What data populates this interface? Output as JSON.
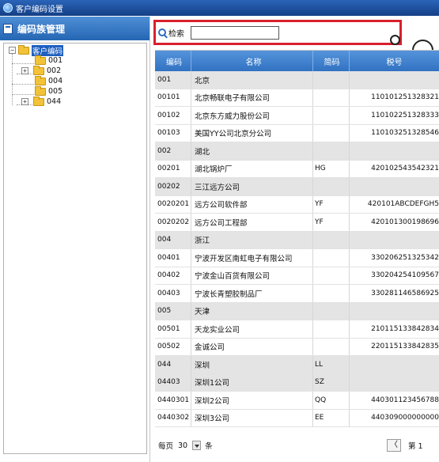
{
  "window": {
    "title": "客户编码设置"
  },
  "left_panel": {
    "title": "编码族管理",
    "tree": {
      "root_label": "客户编码",
      "children": [
        {
          "label": "001",
          "expander": ""
        },
        {
          "label": "002",
          "expander": "+"
        },
        {
          "label": "004",
          "expander": ""
        },
        {
          "label": "005",
          "expander": ""
        },
        {
          "label": "044",
          "expander": "+"
        }
      ],
      "root_expander": "−"
    }
  },
  "search": {
    "label": "检索",
    "value": ""
  },
  "grid": {
    "columns": [
      "编码",
      "名称",
      "简码",
      "税号"
    ],
    "rows": [
      {
        "code": "001",
        "name": "北京",
        "abbr": "",
        "tax": "",
        "group": true
      },
      {
        "code": "00101",
        "name": "北京畅联电子有限公司",
        "abbr": "",
        "tax": "110101251328321",
        "group": false
      },
      {
        "code": "00102",
        "name": "北京东方威力股份公司",
        "abbr": "",
        "tax": "110102251328333",
        "group": false
      },
      {
        "code": "00103",
        "name": "美国YY公司北京分公司",
        "abbr": "",
        "tax": "110103251328546",
        "group": false
      },
      {
        "code": "002",
        "name": "湖北",
        "abbr": "",
        "tax": "",
        "group": true
      },
      {
        "code": "00201",
        "name": "湖北锅炉厂",
        "abbr": "HG",
        "tax": "420102543542321",
        "group": false
      },
      {
        "code": "00202",
        "name": "三江远方公司",
        "abbr": "",
        "tax": "",
        "group": true
      },
      {
        "code": "0020201",
        "name": "远方公司软件部",
        "abbr": "YF",
        "tax": "420101ABCDEFGH5",
        "group": false
      },
      {
        "code": "0020202",
        "name": "远方公司工程部",
        "abbr": "YF",
        "tax": "420101300198696",
        "group": false
      },
      {
        "code": "004",
        "name": "浙江",
        "abbr": "",
        "tax": "",
        "group": true
      },
      {
        "code": "00401",
        "name": "宁波开发区南虹电子有限公司",
        "abbr": "",
        "tax": "330206251325342",
        "group": false
      },
      {
        "code": "00402",
        "name": "宁波金山百货有限公司",
        "abbr": "",
        "tax": "330204254109567",
        "group": false
      },
      {
        "code": "00403",
        "name": "宁波长青塑胶制品厂",
        "abbr": "",
        "tax": "330281146586925",
        "group": false
      },
      {
        "code": "005",
        "name": "天津",
        "abbr": "",
        "tax": "",
        "group": true
      },
      {
        "code": "00501",
        "name": "天龙实业公司",
        "abbr": "",
        "tax": "210115133842834",
        "group": false
      },
      {
        "code": "00502",
        "name": "金诚公司",
        "abbr": "",
        "tax": "220115133842835",
        "group": false
      },
      {
        "code": "044",
        "name": "深圳",
        "abbr": "LL",
        "tax": "",
        "group": true
      },
      {
        "code": "04403",
        "name": "深圳1公司",
        "abbr": "SZ",
        "tax": "",
        "group": true
      },
      {
        "code": "0440301",
        "name": "深圳2公司",
        "abbr": "QQ",
        "tax": "440301123456788",
        "group": false
      },
      {
        "code": "0440302",
        "name": "深圳3公司",
        "abbr": "EE",
        "tax": "440309000000000",
        "group": false
      }
    ]
  },
  "pager": {
    "per_page_label": "每页",
    "per_page_value": "30",
    "unit": "条",
    "prev_label": "〈",
    "page_label": "第 1"
  }
}
